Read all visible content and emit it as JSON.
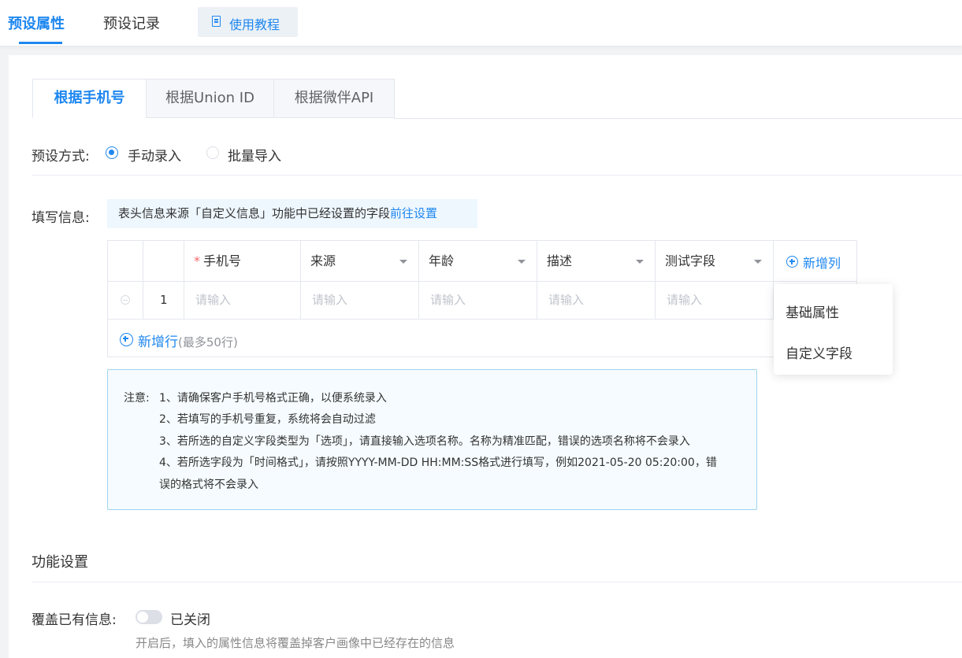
{
  "top_tabs": [
    {
      "label": "预设属性",
      "active": true
    },
    {
      "label": "预设记录",
      "active": false
    }
  ],
  "tutorial": {
    "label": "使用教程",
    "icon": "document-icon"
  },
  "sub_tabs": [
    {
      "label": "根据手机号",
      "active": true
    },
    {
      "label": "根据Union ID",
      "active": false
    },
    {
      "label": "根据微伴API",
      "active": false
    }
  ],
  "preset_method": {
    "label": "预设方式:",
    "options": [
      {
        "label": "手动录入",
        "checked": true
      },
      {
        "label": "批量导入",
        "checked": false
      }
    ]
  },
  "fill_info": {
    "label": "填写信息:",
    "hint": "表头信息来源「自定义信息」功能中已经设置的字段",
    "hint_link": "前往设置"
  },
  "table": {
    "columns": [
      {
        "label": "手机号",
        "required": true,
        "dropdown": false
      },
      {
        "label": "来源",
        "required": false,
        "dropdown": true
      },
      {
        "label": "年龄",
        "required": false,
        "dropdown": true
      },
      {
        "label": "描述",
        "required": false,
        "dropdown": true
      },
      {
        "label": "测试字段",
        "required": false,
        "dropdown": true
      }
    ],
    "add_column": "新增列",
    "rows": [
      {
        "index": "1",
        "placeholders": [
          "请输入",
          "请输入",
          "请输入",
          "请输入",
          "请输入"
        ]
      }
    ],
    "add_row": "新增行",
    "add_row_limit": "(最多50行)"
  },
  "add_column_menu": [
    "基础属性",
    "自定义字段"
  ],
  "notes": {
    "title": "注意:",
    "lines": [
      "1、请确保客户手机号格式正确，以便系统录入",
      "2、若填写的手机号重复，系统将会自动过滤",
      "3、若所选的自定义字段类型为「选项」，请直接输入选项名称。名称为精准匹配，错误的选项名称将不会录入",
      "4、若所选字段为「时间格式」，请按照YYYY-MM-DD HH:MM:SS格式进行填写，例如2021-05-20 05:20:00，错",
      "误的格式将不会录入"
    ]
  },
  "function_settings": {
    "title": "功能设置",
    "overwrite_label": "覆盖已有信息:",
    "switch_on": false,
    "switch_status": "已关闭",
    "description": "开启后，填入的属性信息将覆盖掉客户画像中已经存在的信息"
  },
  "colors": {
    "accent": "#1e87f0",
    "required": "#f56c6c",
    "note_border": "#9fd4ef"
  }
}
